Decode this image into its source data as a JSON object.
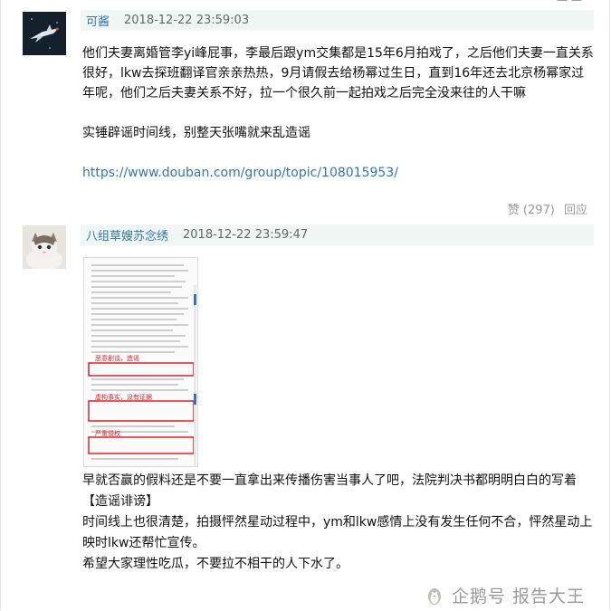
{
  "comments": [
    {
      "username": "可酱",
      "timestamp": "2018-12-22 23:59:03",
      "paragraphs": [
        "他们夫妻离婚管李yi峰屁事，李最后跟ym交集都是15年6月拍戏了，之后他们夫妻一直关系很好，lkw去探班翻译官亲亲热热，9月请假去给杨幂过生日，直到16年还去北京杨幂家过年呢，他们之后夫妻关系不好，拉一个很久前一起拍戏之后完全没来往的人干嘛",
        "实锤辟谣时间线，别整天张嘴就来乱造谣"
      ],
      "link": "https://www.douban.com/group/topic/108015953/",
      "like_label": "赞 (297)",
      "reply_label": "回应"
    },
    {
      "username": "八组草嫂苏念绣",
      "timestamp": "2018-12-22 23:59:47",
      "image_annotations": [
        "恶意剧谈，造谣",
        "虚构事实，没有证据",
        "严重侵权"
      ],
      "lines": [
        "早就否赢的假料还是不要一直拿出来传播伤害当事人了吧，法院判决书都明明白白的写着【造谣诽谤】",
        "时间线上也很清楚，拍摄怦然星动过程中，ym和lkw感情上没有发生任何不合，怦然星动上映时lkw还帮忙宣传。",
        "希望大家理性吃瓜，不要拉不相干的人下水了。"
      ]
    }
  ],
  "watermark": {
    "text": "企鹅号 报告大王",
    "icon": "penguin-icon"
  },
  "colors": {
    "link": "#3377aa",
    "header_bg": "#f0f6f3",
    "annotation_red": "#d9252a"
  }
}
